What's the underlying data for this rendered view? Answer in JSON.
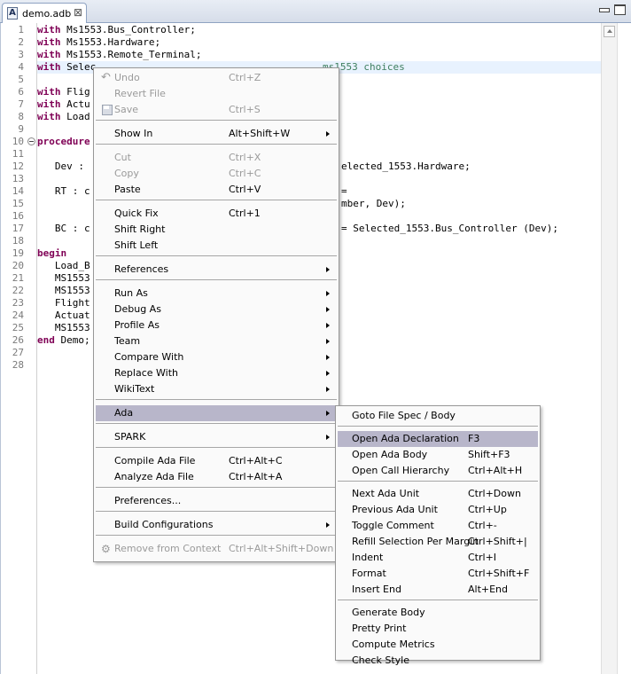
{
  "tab": {
    "title": "demo.adb",
    "icon": "ada-file-icon",
    "close": "⊠"
  },
  "editor": {
    "lines": [
      [
        [
          "kw",
          "with"
        ],
        [
          "",
          "Ms1553.Bus_Controller;"
        ]
      ],
      [
        [
          "kw",
          "with"
        ],
        [
          "",
          "Ms1553.Hardware;"
        ]
      ],
      [
        [
          "kw",
          "with"
        ],
        [
          "",
          "Ms1553.Remote_Terminal;"
        ]
      ],
      [
        [
          "kw",
          "with"
        ],
        [
          "",
          "Selec"
        ]
      ],
      [],
      [
        [
          "kw",
          "with"
        ],
        [
          "",
          "Flig"
        ]
      ],
      [
        [
          "kw",
          "with"
        ],
        [
          "",
          "Actu"
        ]
      ],
      [
        [
          "kw",
          "with"
        ],
        [
          "",
          "Load"
        ]
      ],
      [],
      [
        [
          "kw",
          "procedure"
        ]
      ],
      [],
      [
        [
          "",
          "   Dev : "
        ]
      ],
      [],
      [
        [
          "",
          "   RT : c"
        ]
      ],
      [],
      [],
      [
        [
          "",
          "   BC : c"
        ]
      ],
      [],
      [
        [
          "kw",
          "begin"
        ]
      ],
      [
        [
          "",
          "   Load_B"
        ]
      ],
      [
        [
          "",
          "   MS1553"
        ]
      ],
      [
        [
          "",
          "   MS1553"
        ]
      ],
      [
        [
          "",
          "   Flight"
        ]
      ],
      [
        [
          "",
          "   Actuat"
        ]
      ],
      [
        [
          "",
          "   MS1553"
        ]
      ],
      [
        [
          "kw",
          "end"
        ],
        [
          "",
          "Demo;"
        ]
      ],
      [],
      []
    ],
    "right_fragments": [
      {
        "line": 4,
        "text": "ms1553 choices",
        "cls": "cmt"
      },
      {
        "line": 12,
        "text": "elected_1553.Hardware;",
        "cls": ""
      },
      {
        "line": 14,
        "text": "=",
        "cls": ""
      },
      {
        "line": 15,
        "text": "mber, Dev);",
        "cls": ""
      },
      {
        "line": 17,
        "text": "= Selected_1553.Bus_Controller (Dev);",
        "cls": ""
      }
    ]
  },
  "context_menu": {
    "items": [
      {
        "label": "Undo",
        "accel": "Ctrl+Z",
        "disabled": true,
        "icon": "undo-icon"
      },
      {
        "label": "Revert File",
        "disabled": true
      },
      {
        "label": "Save",
        "accel": "Ctrl+S",
        "disabled": true,
        "icon": "save-icon"
      },
      {
        "sep": true
      },
      {
        "label": "Show In",
        "accel": "Alt+Shift+W",
        "submenu": true
      },
      {
        "sep": true
      },
      {
        "label": "Cut",
        "accel": "Ctrl+X",
        "disabled": true
      },
      {
        "label": "Copy",
        "accel": "Ctrl+C",
        "disabled": true
      },
      {
        "label": "Paste",
        "accel": "Ctrl+V"
      },
      {
        "sep": true
      },
      {
        "label": "Quick Fix",
        "accel": "Ctrl+1"
      },
      {
        "label": "Shift Right"
      },
      {
        "label": "Shift Left"
      },
      {
        "sep": true
      },
      {
        "label": "References",
        "submenu": true
      },
      {
        "sep": true
      },
      {
        "label": "Run As",
        "submenu": true
      },
      {
        "label": "Debug As",
        "submenu": true
      },
      {
        "label": "Profile As",
        "submenu": true
      },
      {
        "label": "Team",
        "submenu": true
      },
      {
        "label": "Compare With",
        "submenu": true
      },
      {
        "label": "Replace With",
        "submenu": true
      },
      {
        "label": "WikiText",
        "submenu": true
      },
      {
        "sep": true
      },
      {
        "label": "Ada",
        "submenu": true,
        "selected": true
      },
      {
        "sep": true
      },
      {
        "label": "SPARK",
        "submenu": true
      },
      {
        "sep": true
      },
      {
        "label": "Compile Ada File",
        "accel": "Ctrl+Alt+C"
      },
      {
        "label": "Analyze Ada File",
        "accel": "Ctrl+Alt+A"
      },
      {
        "sep": true
      },
      {
        "label": "Preferences..."
      },
      {
        "sep": true
      },
      {
        "label": "Build Configurations",
        "submenu": true
      },
      {
        "sep": true
      },
      {
        "label": "Remove from Context",
        "accel": "Ctrl+Alt+Shift+Down",
        "disabled": true,
        "icon": "remove-context-icon"
      }
    ]
  },
  "ada_submenu": {
    "items": [
      {
        "label": "Goto File Spec / Body"
      },
      {
        "sep": true
      },
      {
        "label": "Open Ada Declaration",
        "accel": "F3",
        "selected": true
      },
      {
        "label": "Open Ada Body",
        "accel": "Shift+F3"
      },
      {
        "label": "Open Call Hierarchy",
        "accel": "Ctrl+Alt+H"
      },
      {
        "sep": true
      },
      {
        "label": "Next Ada Unit",
        "accel": "Ctrl+Down"
      },
      {
        "label": "Previous Ada Unit",
        "accel": "Ctrl+Up"
      },
      {
        "label": "Toggle Comment",
        "accel": "Ctrl+-"
      },
      {
        "label": "Refill Selection Per Margin",
        "accel": "Ctrl+Shift+|"
      },
      {
        "label": "Indent",
        "accel": "Ctrl+I"
      },
      {
        "label": "Format",
        "accel": "Ctrl+Shift+F"
      },
      {
        "label": "Insert End",
        "accel": "Alt+End"
      },
      {
        "sep": true
      },
      {
        "label": "Generate Body"
      },
      {
        "label": "Pretty Print"
      },
      {
        "label": "Compute Metrics"
      },
      {
        "label": "Check Style"
      }
    ]
  }
}
